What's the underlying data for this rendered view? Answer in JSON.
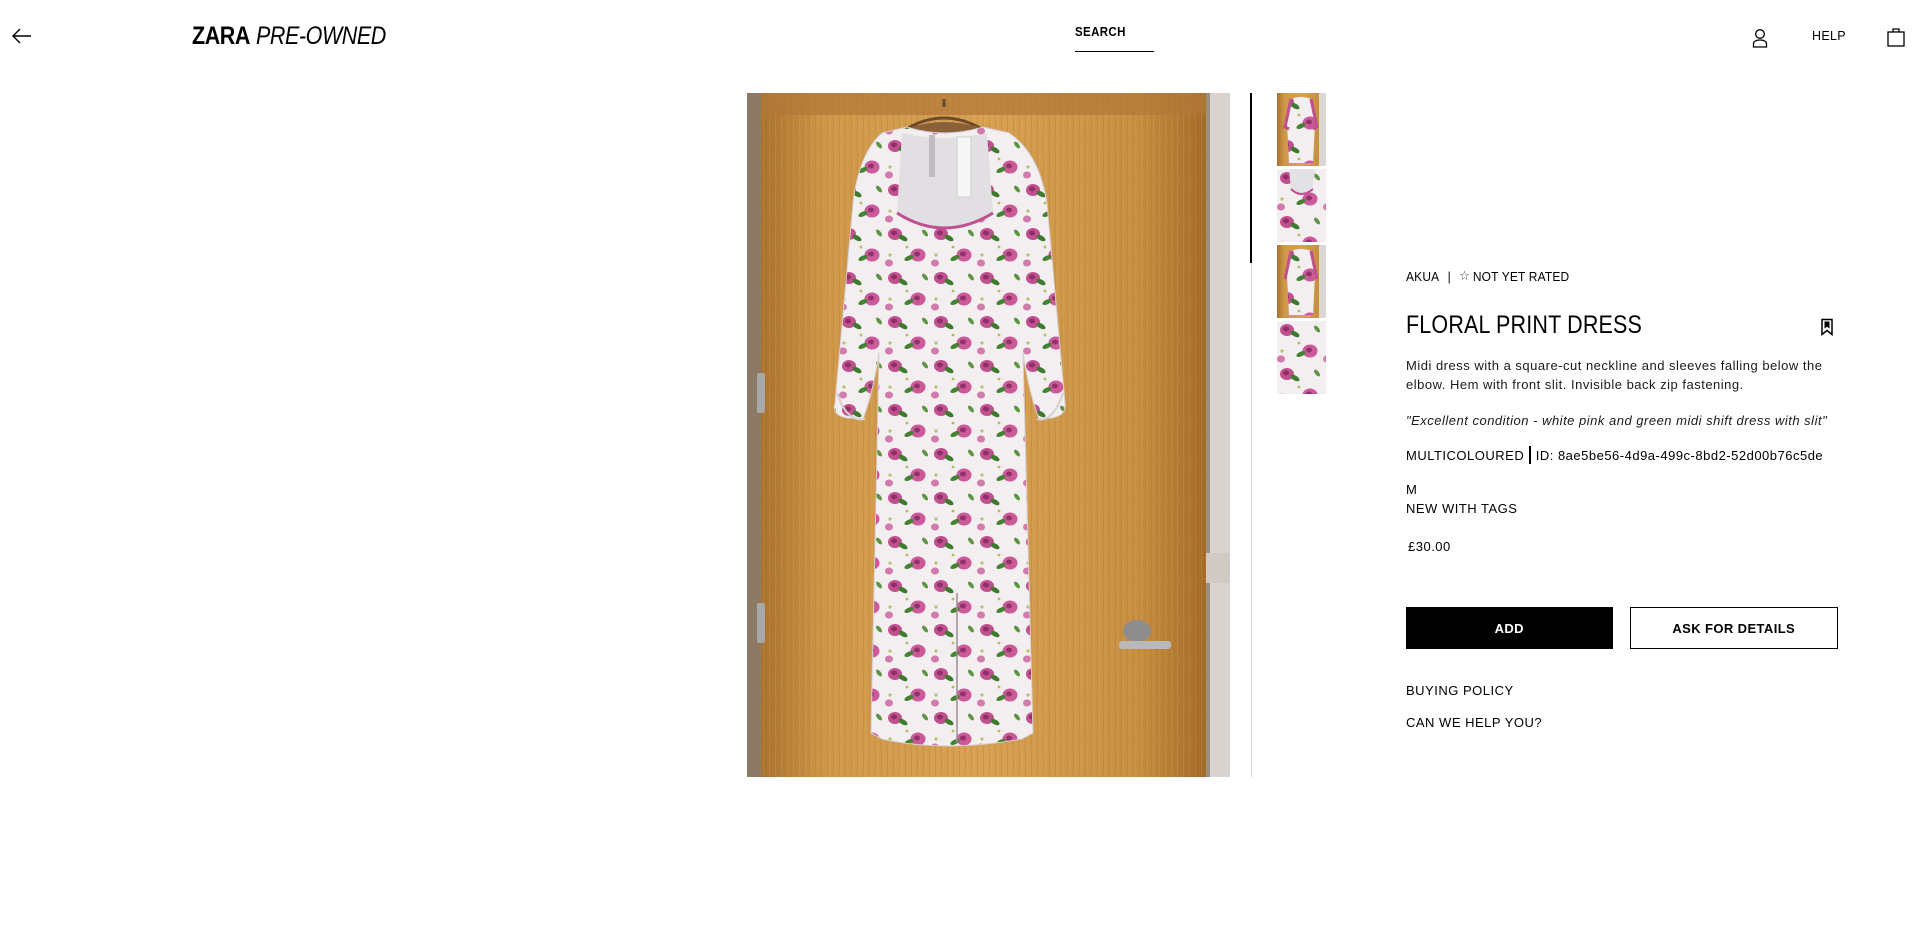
{
  "header": {
    "logo_brand": "ZARA",
    "logo_sub": "PRE-OWNED",
    "search_label": "SEARCH",
    "help_label": "HELP"
  },
  "product": {
    "seller": "AKUA",
    "separator": "|",
    "rating": "NOT YET RATED",
    "title": "FLORAL PRINT DRESS",
    "description": "Midi dress with a square-cut neckline and sleeves falling below the elbow. Hem with front slit. Invisible back zip fastening.",
    "seller_note": "\"Excellent condition - white pink and green midi shift dress with slit\"",
    "colour": "MULTICOLOURED",
    "id_label": "ID: 8ae5be56-4d9a-499c-8bd2-52d00b76c5de",
    "size": "M",
    "condition": "NEW WITH TAGS",
    "price": "£30.00"
  },
  "actions": {
    "add_label": "ADD",
    "ask_label": "ASK FOR DETAILS"
  },
  "links": {
    "buying_policy": "BUYING POLICY",
    "help": "CAN WE HELP YOU?"
  },
  "gallery": {
    "thumbnail_count": 4,
    "active_index": 0
  },
  "icons": {
    "back": "arrow-left-icon",
    "account": "user-icon",
    "bag": "shopping-bag-icon",
    "bookmark": "bookmark-icon",
    "star": "star-outline-icon"
  },
  "colors": {
    "accent": "#000000",
    "background": "#ffffff",
    "door": "#c9913f",
    "dress_pink": "#c0508f",
    "dress_green": "#3e7a2c"
  }
}
